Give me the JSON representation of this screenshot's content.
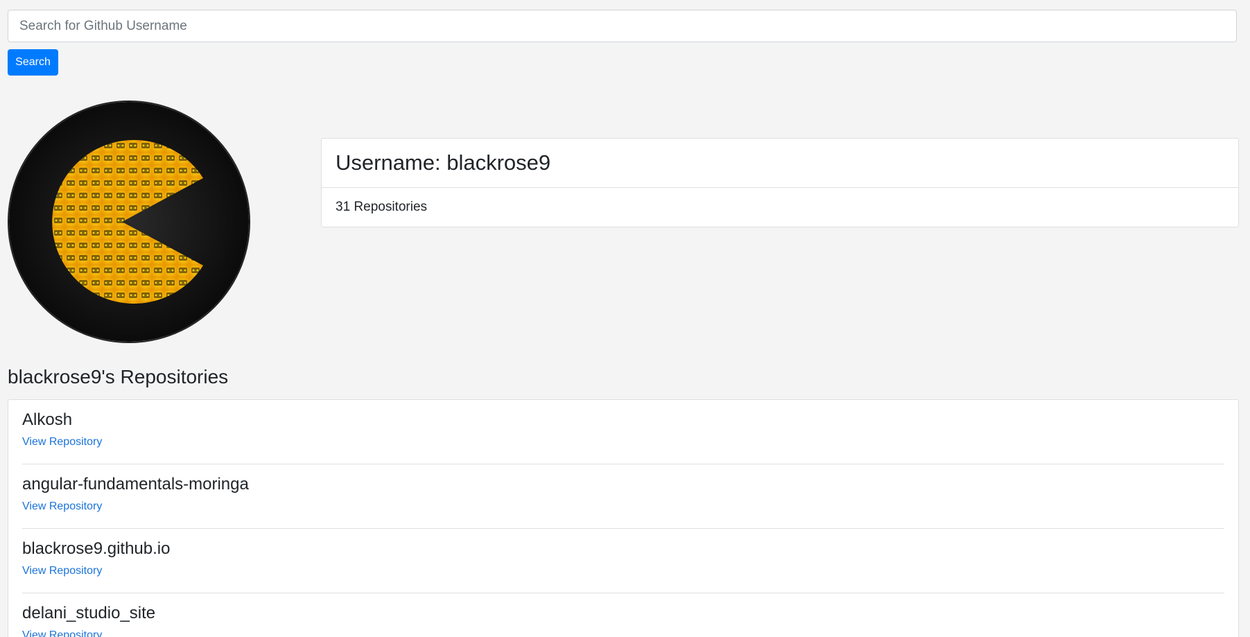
{
  "search": {
    "placeholder": "Search for Github Username",
    "button_label": "Search"
  },
  "profile": {
    "avatar_icon": "pacman-game-controllers-avatar",
    "username_label": "Username: blackrose9",
    "repo_count_label": "31 Repositories"
  },
  "repos": {
    "title": "blackrose9's Repositories",
    "items": [
      {
        "name": "Alkosh",
        "link_label": "View Repository"
      },
      {
        "name": "angular-fundamentals-moringa",
        "link_label": "View Repository"
      },
      {
        "name": "blackrose9.github.io",
        "link_label": "View Repository"
      },
      {
        "name": "delani_studio_site",
        "link_label": "View Repository"
      }
    ]
  },
  "colors": {
    "background": "#f4f4f4",
    "primary": "#007bff",
    "link": "#1a73d9",
    "avatar_accent": "#f5b800"
  }
}
